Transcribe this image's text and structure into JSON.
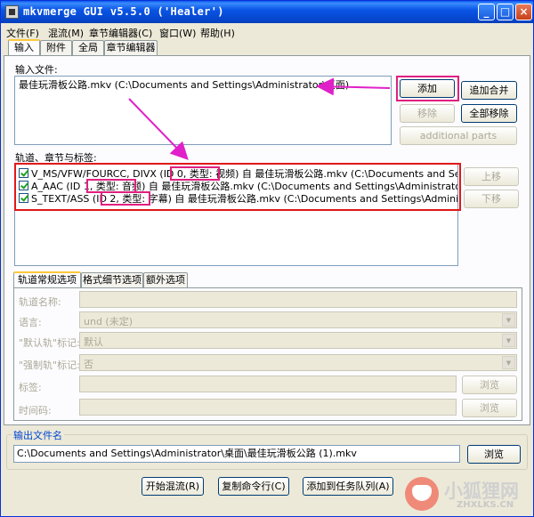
{
  "window": {
    "title": "mkvmerge GUI v5.5.0 ('Healer')",
    "min_label": "_",
    "max_label": "□",
    "close_label": "×"
  },
  "menu": [
    "文件(F)",
    "混流(M)",
    "章节编辑器(C)",
    "窗口(W)",
    "帮助(H)"
  ],
  "main_tabs": [
    "输入",
    "附件",
    "全局",
    "章节编辑器"
  ],
  "input": {
    "files_label": "输入文件:",
    "file": "最佳玩滑板公路.mkv (C:\\Documents and Settings\\Administrator\\桌面)",
    "add_button": "添加",
    "append_button": "追加合并",
    "remove_button": "移除",
    "remove_all_button": "全部移除",
    "additional_parts_button": "additional parts"
  },
  "tracks": {
    "label": "轨道、章节与标签:",
    "rows": [
      {
        "pre": "V_MS/VFW/FOURCC, DIVX (ID 0, ",
        "type": "类型: 视频",
        "post": ") 自 最佳玩滑板公路.mkv (C:\\Documents and Settings\\Ad"
      },
      {
        "pre": "A_AAC (ID 1, ",
        "type": "类型: 音频",
        "post": ") 自 最佳玩滑板公路.mkv (C:\\Documents and Settings\\Administrator\\桌面)"
      },
      {
        "pre": "S_TEXT/ASS (ID 2, ",
        "type": "类型: 字幕",
        "post": ") 自 最佳玩滑板公路.mkv (C:\\Documents and Settings\\Administrator\\桌"
      }
    ],
    "up_button": "上移",
    "down_button": "下移"
  },
  "sub_tabs": [
    "轨道常规选项",
    "格式细节选项",
    "额外选项"
  ],
  "options": {
    "track_name_label": "轨道名称:",
    "language_label": "语言:",
    "language_value": "und (未定)",
    "default_label": "\"默认轨\"标记:",
    "default_value": "默认",
    "forced_label": "\"强制轨\"标记:",
    "forced_value": "否",
    "tags_label": "标签:",
    "timecodes_label": "时间码:",
    "browse_button": "浏览"
  },
  "output": {
    "group_title": "输出文件名",
    "path": "C:\\Documents and Settings\\Administrator\\桌面\\最佳玩滑板公路 (1).mkv",
    "browse_button": "浏览"
  },
  "actions": {
    "start_mux": "开始混流(R)",
    "copy_cmd": "复制命令行(C)",
    "add_queue": "添加到任务队列(A)"
  },
  "watermark": {
    "cn": "小狐狸网",
    "en": "ZHXLKS.CN"
  },
  "colors": {
    "title_blue": "#0a55e6",
    "highlight_pink": "#e02080",
    "highlight_red": "#e01818",
    "group_title": "#0046d5"
  }
}
